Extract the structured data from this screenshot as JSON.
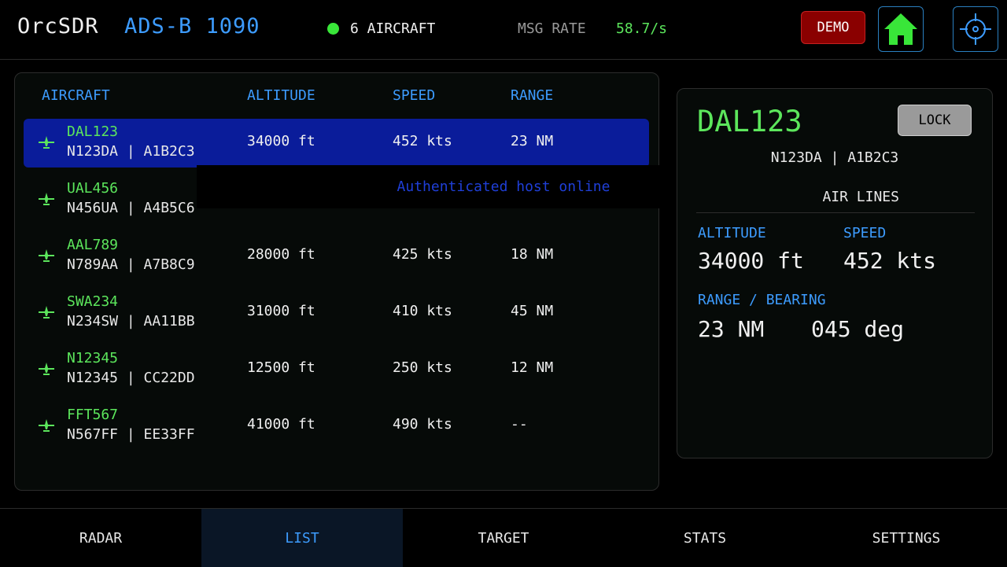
{
  "header": {
    "app_title": "OrcSDR",
    "mode_title": "ADS-B 1090",
    "aircraft_count": "6 AIRCRAFT",
    "msg_rate_label": "MSG RATE",
    "msg_rate_value": "58.7/s",
    "demo_label": "DEMO",
    "home_icon": "home-icon",
    "target_icon": "crosshair-icon",
    "status_color": "#39e639"
  },
  "list": {
    "columns": {
      "aircraft": "AIRCRAFT",
      "altitude": "ALTITUDE",
      "speed": "SPEED",
      "range": "RANGE"
    },
    "selected_index": 0,
    "rows": [
      {
        "callsign": "DAL123",
        "ids": "N123DA | A1B2C3",
        "altitude": "34000 ft",
        "speed": "452 kts",
        "range": "23 NM"
      },
      {
        "callsign": "UAL456",
        "ids": "N456UA | A4B5C6",
        "altitude": "",
        "speed": "",
        "range": ""
      },
      {
        "callsign": "AAL789",
        "ids": "N789AA | A7B8C9",
        "altitude": "28000 ft",
        "speed": "425 kts",
        "range": "18 NM"
      },
      {
        "callsign": "SWA234",
        "ids": "N234SW | AA11BB",
        "altitude": "31000 ft",
        "speed": "410 kts",
        "range": "45 NM"
      },
      {
        "callsign": "N12345",
        "ids": "N12345 | CC22DD",
        "altitude": "12500 ft",
        "speed": "250 kts",
        "range": "12 NM"
      },
      {
        "callsign": "FFT567",
        "ids": "N567FF | EE33FF",
        "altitude": "41000 ft",
        "speed": "490 kts",
        "range": "--"
      }
    ]
  },
  "toast": {
    "message": "Authenticated host online"
  },
  "detail": {
    "callsign": "DAL123",
    "lock_label": "LOCK",
    "ids": "N123DA | A1B2C3",
    "airline": "AIR LINES",
    "altitude_label": "ALTITUDE",
    "altitude_value": "34000 ft",
    "speed_label": "SPEED",
    "speed_value": "452 kts",
    "range_bearing_label": "RANGE / BEARING",
    "range_value": "23 NM",
    "bearing_value": "045 deg"
  },
  "tabs": [
    {
      "label": "RADAR",
      "active": false
    },
    {
      "label": "LIST",
      "active": true
    },
    {
      "label": "TARGET",
      "active": false
    },
    {
      "label": "STATS",
      "active": false
    },
    {
      "label": "SETTINGS",
      "active": false
    }
  ],
  "colors": {
    "accent_blue": "#3d9cff",
    "callsign_green": "#5ce65c",
    "selected_row": "#0a1c9a",
    "demo_red": "#8a0000"
  }
}
